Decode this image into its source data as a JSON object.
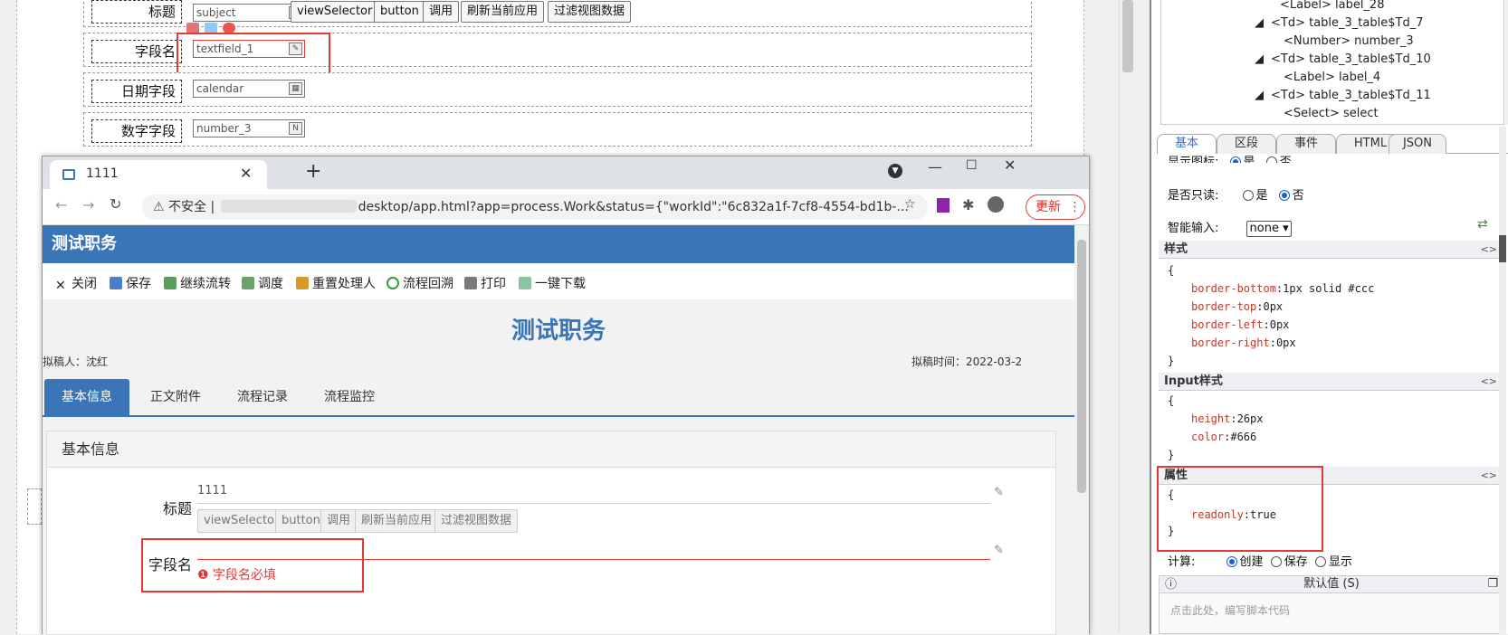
{
  "designer": {
    "rows": [
      {
        "label": "标题",
        "field": "subject"
      },
      {
        "label": "字段名",
        "field": "textfield_1"
      },
      {
        "label": "日期字段",
        "field": "calendar"
      },
      {
        "label": "数字字段",
        "field": "number_3"
      }
    ],
    "buttons": [
      "viewSelector",
      "button",
      "调用",
      "刷新当前应用",
      "过滤视图数据"
    ]
  },
  "tree": [
    "<Label> label_28",
    "<Td> table_3_table$Td_7",
    "<Number> number_3",
    "<Td> table_3_table$Td_10",
    "<Label> label_4",
    "<Td> table_3_table$Td_11",
    "<Select> select"
  ],
  "prop_tabs": [
    "基本",
    "区段",
    "事件",
    "HTML",
    "JSON"
  ],
  "props": {
    "show_icon": {
      "label": "显示图标:",
      "yes": "是",
      "no": "否"
    },
    "readonly": {
      "label": "是否只读:",
      "yes": "是",
      "no": "否"
    },
    "smart_input": {
      "label": "智能输入:",
      "value": "none"
    },
    "style_head": "样式",
    "style_code": [
      "{",
      "border-bottom",
      "1px solid #ccc",
      "border-top",
      "0px",
      "border-left",
      "0px",
      "border-right",
      "0px",
      "}"
    ],
    "input_style_head": "Input样式",
    "input_style_code": [
      "height",
      "26px",
      "color",
      "#666"
    ],
    "attr_head": "属性",
    "attr_code": [
      "readonly",
      "true"
    ],
    "calc": {
      "label": "计算:",
      "opt1": "创建",
      "opt2": "保存",
      "opt3": "显示"
    },
    "default_head": "默认值 (S)",
    "default_placeholder": "点击此处，编写脚本代码",
    "toggle": "<>"
  },
  "browser": {
    "tab_title": "1111",
    "insecure": "不安全",
    "url": "desktop/app.html?app=process.Work&status={\"workId\":\"6c832a1f-7cf8-4554-bd1b-...",
    "update": "更新",
    "app_title": "测试职务",
    "tools": [
      "关闭",
      "保存",
      "继续流转",
      "调度",
      "重置处理人",
      "流程回溯",
      "打印",
      "一键下载"
    ],
    "doc_title": "测试职务",
    "drafter": "拟稿人：沈红",
    "draft_time": "拟稿时间：2022-03-2",
    "form_tabs": [
      "基本信息",
      "正文附件",
      "流程记录",
      "流程监控"
    ],
    "section": "基本信息",
    "title_label": "标题",
    "title_value": "1111",
    "field_label": "字段名",
    "required_msg": "字段名必填"
  }
}
